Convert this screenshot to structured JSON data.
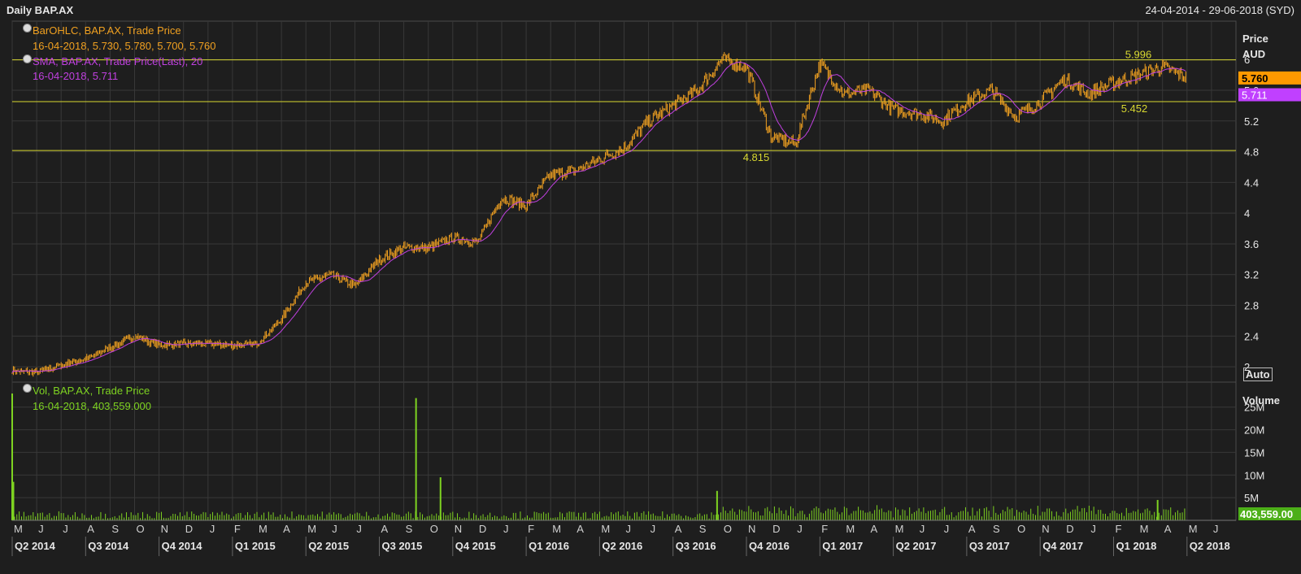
{
  "header": {
    "title": "Daily BAP.AX",
    "date_range": "24-04-2014 - 29-06-2018 (SYD)"
  },
  "legend": {
    "ohlc_name": "BarOHLC, BAP.AX, Trade Price",
    "ohlc_values": "16-04-2018, 5.730, 5.780, 5.700, 5.760",
    "sma_name": "SMA, BAP.AX, Trade Price(Last),  20",
    "sma_values": "16-04-2018, 5.711",
    "vol_name": "Vol, BAP.AX, Trade Price",
    "vol_values": "16-04-2018, 403,559.000"
  },
  "axes": {
    "price_title": "Price",
    "price_unit": "AUD",
    "volume_title": "Volume",
    "auto_button": "Auto"
  },
  "colors": {
    "background": "#1e1e1e",
    "grid": "#383838",
    "ohlc": "#f0a020",
    "sma": "#c040e0",
    "volume": "#7ed321",
    "hline": "#d8d830",
    "last_price_tag": "#ff9900",
    "sma_tag": "#c040ff",
    "volume_tag": "#4caf18"
  },
  "chart_data": [
    {
      "type": "ohlc",
      "title": "Daily BAP.AX",
      "series": [
        {
          "name": "BarOHLC, BAP.AX, Trade Price",
          "x": [
            "2014-04",
            "2014-05",
            "2014-06",
            "2014-07",
            "2014-08",
            "2014-09",
            "2014-10",
            "2014-11",
            "2014-12",
            "2015-01",
            "2015-02",
            "2015-03",
            "2015-04",
            "2015-05",
            "2015-06",
            "2015-07",
            "2015-08",
            "2015-09",
            "2015-10",
            "2015-11",
            "2015-12",
            "2016-01",
            "2016-02",
            "2016-03",
            "2016-04",
            "2016-05",
            "2016-06",
            "2016-07",
            "2016-08",
            "2016-09",
            "2016-10",
            "2016-11",
            "2016-12",
            "2017-01",
            "2017-02",
            "2017-03",
            "2017-04",
            "2017-05",
            "2017-06",
            "2017-07",
            "2017-08",
            "2017-09",
            "2017-10",
            "2017-11",
            "2017-12",
            "2018-01",
            "2018-02",
            "2018-03",
            "2018-04"
          ],
          "close": [
            1.95,
            1.93,
            2.02,
            2.1,
            2.25,
            2.4,
            2.28,
            2.3,
            2.3,
            2.28,
            2.3,
            2.62,
            3.1,
            3.2,
            3.05,
            3.4,
            3.55,
            3.55,
            3.68,
            3.62,
            4.2,
            4.1,
            4.5,
            4.55,
            4.7,
            4.85,
            5.2,
            5.4,
            5.6,
            6.0,
            5.9,
            5.0,
            4.9,
            5.95,
            5.55,
            5.6,
            5.35,
            5.3,
            5.2,
            5.45,
            5.6,
            5.25,
            5.45,
            5.75,
            5.55,
            5.7,
            5.8,
            5.9,
            5.76
          ],
          "last": {
            "date": "16-04-2018",
            "open": 5.73,
            "high": 5.78,
            "low": 5.7,
            "close": 5.76
          }
        },
        {
          "name": "SMA, BAP.AX, Trade Price(Last),  20",
          "last": {
            "date": "16-04-2018",
            "value": 5.711
          }
        }
      ],
      "hlines": [
        5.996,
        5.452,
        4.815
      ],
      "ylim": [
        1.8,
        6.5
      ],
      "yticks": [
        "6",
        "5.6",
        "5.2",
        "4.8",
        "4.4",
        "4",
        "3.6",
        "3.2",
        "2.8",
        "2.4",
        "2"
      ],
      "ylabel": "Price AUD",
      "last_price_label": "5.760",
      "sma_label": "5.711",
      "grid": true
    },
    {
      "type": "bar",
      "title": "",
      "series": [
        {
          "name": "Vol, BAP.AX, Trade Price",
          "spikes": [
            {
              "date": "2014-04",
              "value": 28000000
            },
            {
              "date": "2014-04",
              "value": 8500000
            },
            {
              "date": "2015-09",
              "value": 27000000
            },
            {
              "date": "2015-10",
              "value": 9500000
            },
            {
              "date": "2016-09",
              "value": 6500000
            },
            {
              "date": "2018-03",
              "value": 4500000
            }
          ],
          "last": {
            "date": "16-04-2018",
            "value": 403559
          }
        }
      ],
      "ylim": [
        0,
        28000000
      ],
      "yticks": [
        "25M",
        "20M",
        "15M",
        "10M",
        "5M"
      ],
      "ylabel": "Volume",
      "last_value_label": "403,559.00",
      "grid": true
    }
  ],
  "time_axis": {
    "months": [
      "M",
      "J",
      "J",
      "A",
      "S",
      "O",
      "N",
      "D",
      "J",
      "F",
      "M",
      "A",
      "M",
      "J",
      "J",
      "A",
      "S",
      "O",
      "N",
      "D",
      "J",
      "F",
      "M",
      "A",
      "M",
      "J",
      "J",
      "A",
      "S",
      "O",
      "N",
      "D",
      "J",
      "F",
      "M",
      "A",
      "M",
      "J",
      "J",
      "A",
      "S",
      "O",
      "N",
      "D",
      "J",
      "F",
      "M",
      "A",
      "M",
      "J"
    ],
    "quarters": [
      "Q2 2014",
      "Q3 2014",
      "Q4 2014",
      "Q1 2015",
      "Q2 2015",
      "Q3 2015",
      "Q4 2015",
      "Q1 2016",
      "Q2 2016",
      "Q3 2016",
      "Q4 2016",
      "Q1 2017",
      "Q2 2017",
      "Q3 2017",
      "Q4 2017",
      "Q1 2018",
      "Q2 2018"
    ]
  }
}
